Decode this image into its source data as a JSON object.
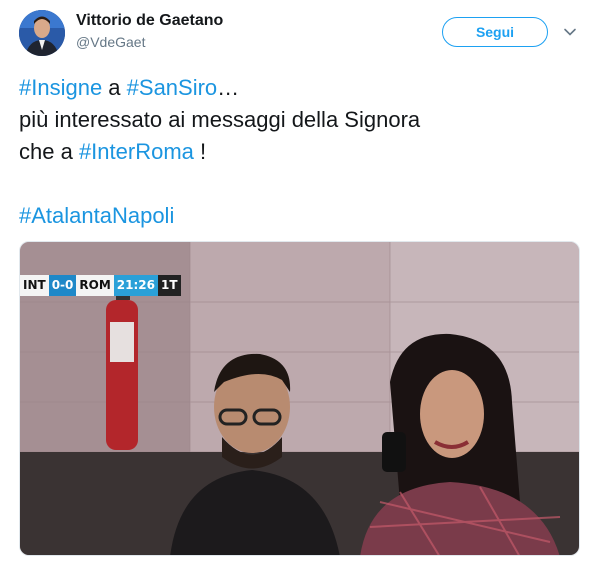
{
  "author": {
    "display_name": "Vittorio de Gaetano",
    "handle": "@VdeGaet"
  },
  "actions": {
    "follow_label": "Segui",
    "menu_icon": "chevron-down-icon"
  },
  "tweet": {
    "line1": {
      "tag1": "#Insigne",
      "mid": " a ",
      "tag2": "#SanSiro",
      "end": "…"
    },
    "line2": "più interessato ai messaggi della Signora",
    "line3": {
      "start": "che a ",
      "tag": "#InterRoma",
      "end": " !"
    },
    "line5": {
      "tag": "#AtalantaNapoli"
    }
  },
  "media": {
    "scorebug": {
      "home": "INT",
      "result": "0-0",
      "away": "ROM",
      "clock": "21:26",
      "half": "1T"
    }
  },
  "colors": {
    "link": "#1b95e0",
    "follow_border": "#1da1f2"
  }
}
